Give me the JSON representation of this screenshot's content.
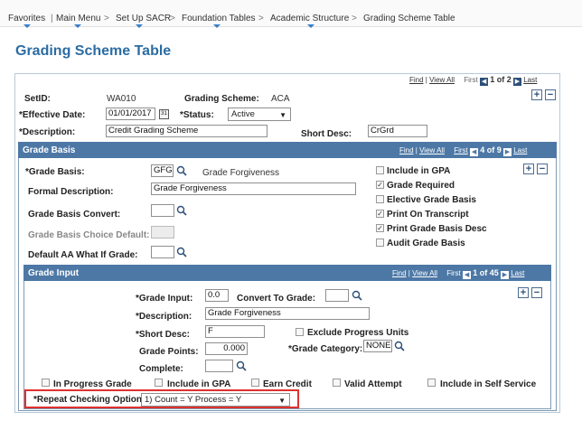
{
  "nav": {
    "favorites": "Favorites",
    "main_menu": "Main Menu",
    "set_up_sacr": "Set Up SACR",
    "foundation_tables": "Foundation Tables",
    "academic_structure": "Academic Structure",
    "current_page": "Grading Scheme Table",
    "separator": ">"
  },
  "page_title": "Grading Scheme Table",
  "scroll_nav": {
    "find": "Find",
    "divider": "|",
    "view_all": "View All",
    "first": "First",
    "last": "Last",
    "prev_glyph": "◀",
    "next_glyph": "▶"
  },
  "scheme": {
    "counter": "1 of 2",
    "setid_label": "SetID:",
    "setid_value": "WA010",
    "scheme_label": "Grading Scheme:",
    "scheme_value": "ACA",
    "eff_date_label": "*Effective Date:",
    "eff_date_value": "01/01/2017",
    "status_label": "*Status:",
    "status_value": "Active",
    "desc_label": "*Description:",
    "desc_value": "Credit Grading Scheme",
    "short_desc_label": "Short Desc:",
    "short_desc_value": "CrGrd"
  },
  "grade_basis": {
    "header": "Grade Basis",
    "counter": "4 of 9",
    "basis_label": "*Grade Basis:",
    "basis_value": "GFG",
    "basis_desc": "Grade Forgiveness",
    "formal_label": "Formal Description:",
    "formal_value": "Grade Forgiveness",
    "convert_label": "Grade Basis Convert:",
    "choice_default_label": "Grade Basis Choice Default:",
    "default_aa_label": "Default AA What If Grade:",
    "checkboxes": [
      {
        "label": "Include in GPA",
        "checked": false
      },
      {
        "label": "Grade Required",
        "checked": true
      },
      {
        "label": "Elective Grade Basis",
        "checked": false
      },
      {
        "label": "Print On Transcript",
        "checked": true
      },
      {
        "label": "Print Grade Basis Desc",
        "checked": true
      },
      {
        "label": "Audit Grade Basis",
        "checked": false
      }
    ]
  },
  "grade_input": {
    "header": "Grade Input",
    "counter": "1 of 45",
    "input_label": "*Grade Input:",
    "input_value": "0.0",
    "convert_label": "Convert To Grade:",
    "desc_label": "*Description:",
    "desc_value": "Grade Forgiveness",
    "short_desc_label": "*Short Desc:",
    "short_desc_value": "F",
    "exclude_label": "Exclude Progress Units",
    "points_label": "Grade Points:",
    "points_value": "0.000",
    "category_label": "*Grade Category:",
    "category_value": "NONE",
    "complete_label": "Complete:",
    "bottom_checks": [
      {
        "label": "In Progress Grade",
        "checked": false
      },
      {
        "label": "Include in GPA",
        "checked": false
      },
      {
        "label": "Earn Credit",
        "checked": false
      },
      {
        "label": "Valid Attempt",
        "checked": false
      },
      {
        "label": "Include in Self Service",
        "checked": false
      }
    ],
    "repeat_label": "*Repeat Checking Option:",
    "repeat_value": "1) Count = Y  Process = Y"
  },
  "icons": {
    "add": "+",
    "remove": "−",
    "caret": "▼",
    "check": "✓"
  },
  "colors": {
    "title": "#2b6ca3",
    "header_bar": "#4d78a6",
    "highlight": "#e0312e"
  }
}
